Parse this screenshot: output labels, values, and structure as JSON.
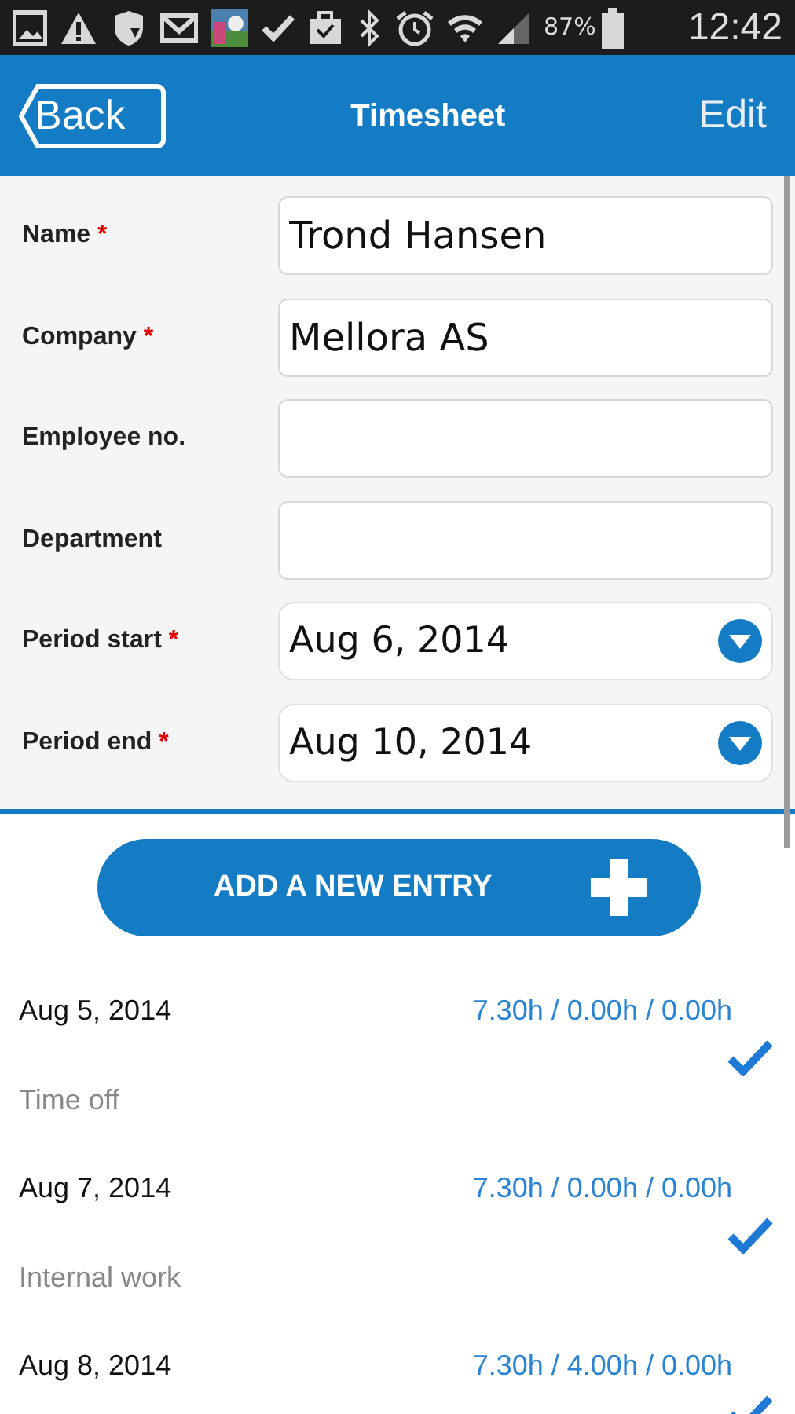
{
  "status_bar": {
    "battery": "87%",
    "time": "12:42"
  },
  "header": {
    "back": "Back",
    "title": "Timesheet",
    "edit": "Edit"
  },
  "form": [
    {
      "label": "Name",
      "required_mark": "*",
      "kind": "text",
      "value": "Trond Hansen"
    },
    {
      "label": "Company",
      "required_mark": "*",
      "kind": "text",
      "value": "Mellora AS"
    },
    {
      "label": "Employee no.",
      "kind": "text"
    },
    {
      "label": "Department",
      "kind": "text"
    },
    {
      "label": "Period start",
      "required_mark": "*",
      "kind": "date",
      "value": "Aug 6, 2014"
    },
    {
      "label": "Period end",
      "required_mark": "*",
      "kind": "date",
      "value": "Aug 10, 2014"
    }
  ],
  "add_button": "ADD A NEW ENTRY",
  "entries": [
    {
      "date": "Aug 5, 2014",
      "hours": "7.30h / 0.00h / 0.00h",
      "description": "Time off",
      "checked": true
    },
    {
      "date": "Aug 7, 2014",
      "hours": "7.30h / 0.00h / 0.00h",
      "description": "Internal work",
      "checked": true
    },
    {
      "date": "Aug 8, 2014",
      "hours": "7.30h / 4.00h / 0.00h",
      "checked": true
    }
  ]
}
